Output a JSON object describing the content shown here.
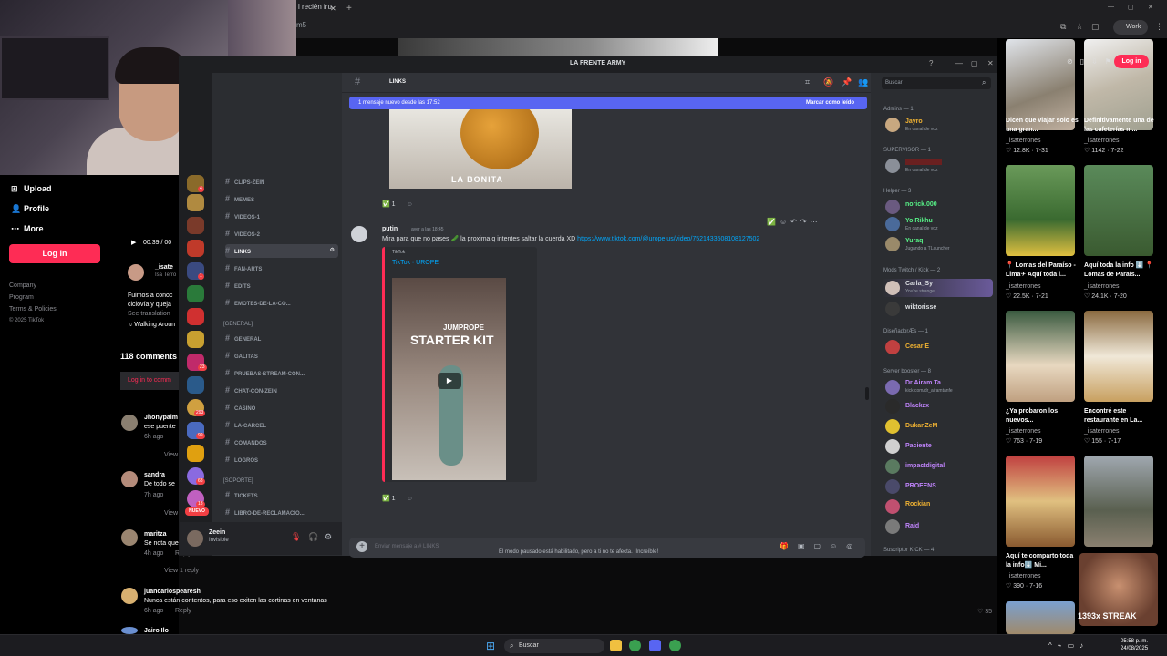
{
  "browser": {
    "tab_title": "l recién iru",
    "url": "m5",
    "profile_label": "Work"
  },
  "tiktok_left": {
    "nav": [
      {
        "icon": "upload-icon",
        "label": "Upload"
      },
      {
        "icon": "profile-icon",
        "label": "Profile"
      },
      {
        "icon": "more-icon",
        "label": "More"
      }
    ],
    "login_label": "Log in",
    "footer": [
      "Company",
      "Program",
      "Terms & Policies",
      "© 2025 TikTok"
    ],
    "video_time": "00:39 / 00",
    "author": "_isate",
    "author_sub": "Isa Terro",
    "caption_1": "Fuimos a conoc",
    "caption_2": "ciclovía y queja",
    "see_translation": "See translation",
    "music": "♫ Walking Aroun",
    "comments_count": "118 comments",
    "login_to_comment": "Log in to comm",
    "comments": [
      {
        "user": "Jhonypalm",
        "text": "ese puente",
        "time": "6h ago",
        "view": "View"
      },
      {
        "user": "sandra",
        "text": "De todo se",
        "time": "7h ago",
        "view": "View"
      },
      {
        "user": "maritza",
        "text": "Se nota que",
        "time": "4h ago",
        "reply": "Reply",
        "view": "View 1 reply"
      },
      {
        "user": "juancarlospearesh",
        "text": "Nunca están contentos, para eso exiten las cortinas en ventanas",
        "time": "6h ago",
        "reply": "Reply"
      },
      {
        "user": "Jairo Ilo",
        "text": ""
      }
    ]
  },
  "discord": {
    "window_title": "LA FRENTE ARMY",
    "channel_name": "LINKS",
    "new_messages_bar": "1 mensaje nuevo desde las 17:52",
    "mark_read": "Marcar como leído",
    "servers": [
      {
        "badge": "4"
      },
      {
        "badge": ""
      },
      {
        "badge": ""
      },
      {
        "badge": ""
      },
      {
        "badge": "1"
      },
      {
        "badge": ""
      },
      {
        "badge": ""
      },
      {
        "badge": "23"
      },
      {
        "badge": ""
      },
      {
        "badge": "293"
      },
      {
        "badge": "99"
      },
      {
        "badge": ""
      },
      {
        "badge": "68"
      },
      {
        "badge": "13"
      }
    ],
    "nuevo_label": "NUEVO",
    "channels": [
      {
        "name": "CLIPS-ZEIN",
        "active": false
      },
      {
        "name": "MEMES",
        "active": false
      },
      {
        "name": "VIDEOS-1",
        "active": false
      },
      {
        "name": "VIDEOS-2",
        "active": false
      },
      {
        "name": "LINKS",
        "active": true
      },
      {
        "name": "FAN-ARTS",
        "active": false
      },
      {
        "name": "EDITS",
        "active": false
      },
      {
        "name": "EMOTES-DE-LA-CO...",
        "active": false
      }
    ],
    "category_general": "[GENERAL]",
    "general_channels": [
      {
        "name": "GENERAL"
      },
      {
        "name": "GALITAS"
      },
      {
        "name": "PRUEBAS-STREAM-CON..."
      },
      {
        "name": "CHAT-CON-ZEIN"
      },
      {
        "name": "CASINO"
      },
      {
        "name": "LA-CARCEL"
      },
      {
        "name": "COMANDOS"
      },
      {
        "name": "LOGROS"
      }
    ],
    "category_soporte": "[SOPORTE]",
    "soporte_channels": [
      {
        "name": "TICKETS"
      },
      {
        "name": "LIBRO-DE-RECLAMACIO..."
      }
    ],
    "user": {
      "name": "Zeein",
      "status": "Invisible"
    },
    "image_caption": "LA BONITA",
    "reaction_count_1": "1",
    "message": {
      "author": "putin",
      "time": "ayer a las 18:45",
      "text": "Mira para que no pases 🥒 la proxima q intentes saltar la cuerda XD",
      "link": "https://www.tiktok.com/@urope.us/video/7521433508108127502"
    },
    "embed": {
      "provider": "TikTok",
      "title": "TikTok · UROPE",
      "video_line1": "JUMPROPE",
      "video_line2": "STARTER KIT"
    },
    "reaction_count_2": "1",
    "input_placeholder": "Enviar mensaje a #  LINKS",
    "slowmode_notice": "El modo pausado está habilitado, pero a ti no te afecta. ¡Increíble!",
    "search_placeholder": "Buscar",
    "member_groups": [
      {
        "header": "Admins — 1",
        "members": [
          {
            "name": "Jayro",
            "sub": "En canal de voz",
            "color": "#f0b232"
          }
        ]
      },
      {
        "header": "SUPERVISOR — 1",
        "members": [
          {
            "name": "",
            "sub": "En canal de voz",
            "color": "#e0404a"
          }
        ]
      },
      {
        "header": "Helper — 3",
        "members": [
          {
            "name": "norick.000",
            "sub": "",
            "color": "#57f287"
          },
          {
            "name": "Yo Rikhu",
            "sub": "En canal de voz",
            "color": "#57f287"
          },
          {
            "name": "Yuraq",
            "sub": "Jugando a TLauncher",
            "color": "#57f287"
          }
        ]
      },
      {
        "header": "Mods Twitch / Kick — 2",
        "members": [
          {
            "name": "Carla_Sy",
            "sub": "You're strange...",
            "color": "#dbdee1"
          },
          {
            "name": "wiktorisse",
            "sub": "",
            "color": "#dbdee1"
          }
        ]
      },
      {
        "header": "DiseñadorÆs — 1",
        "members": [
          {
            "name": "Cesar E",
            "sub": "",
            "color": "#f0b232"
          }
        ]
      },
      {
        "header": "Server booster — 8",
        "members": [
          {
            "name": "Dr Airam Ta",
            "sub": "kick.com/dr_airamtanfe",
            "color": "#c084fc"
          },
          {
            "name": "Blackzx",
            "sub": "",
            "color": "#c084fc"
          },
          {
            "name": "DukanZeM",
            "sub": "",
            "color": "#f0b232"
          },
          {
            "name": "Paciente",
            "sub": "",
            "color": "#c084fc"
          },
          {
            "name": "impactdigital",
            "sub": "",
            "color": "#c084fc"
          },
          {
            "name": "PROFENS",
            "sub": "",
            "color": "#c084fc"
          },
          {
            "name": "Rockian",
            "sub": "",
            "color": "#f0b232"
          },
          {
            "name": "Raid",
            "sub": "",
            "color": "#c084fc"
          }
        ]
      },
      {
        "header": "Suscriptor KICK — 4",
        "members": []
      }
    ]
  },
  "tiktok_right": {
    "login_label": "Log in",
    "videos": [
      {
        "title": "Dicen que viajar solo es una gran...",
        "user": "_isaterrones",
        "views": "12.8K",
        "date": "7-31"
      },
      {
        "title": "Definitivamente una de las cafeterías m...",
        "user": "_isaterrones",
        "views": "1142",
        "date": "7-22"
      },
      {
        "title": "📍 Lomas del Paraíso - Lima✈ Aquí toda l...",
        "user": "_isaterrones",
        "views": "22.5K",
        "date": "7-21"
      },
      {
        "title": "Aquí toda la info ⬇️ 📍Lomas de Paraís...",
        "user": "_isaterrones",
        "views": "24.1K",
        "date": "7-20"
      },
      {
        "title": "¿Ya probaron los nuevos...",
        "user": "_isaterrones",
        "views": "763",
        "date": "7-19"
      },
      {
        "title": "Encontré este restaurante en La...",
        "user": "_isaterrones",
        "views": "155",
        "date": "7-17"
      },
      {
        "title": "Aquí te comparto toda la info⬇️ Mi...",
        "user": "_isaterrones",
        "views": "390",
        "date": "7-16"
      },
      {
        "title": "",
        "user": "",
        "views": "",
        "date": ""
      }
    ],
    "like_count": "35",
    "streak": "1393x STREAK"
  },
  "taskbar": {
    "search_label": "Buscar",
    "time": "05:58 p. m.",
    "date": "24/08/2025"
  }
}
